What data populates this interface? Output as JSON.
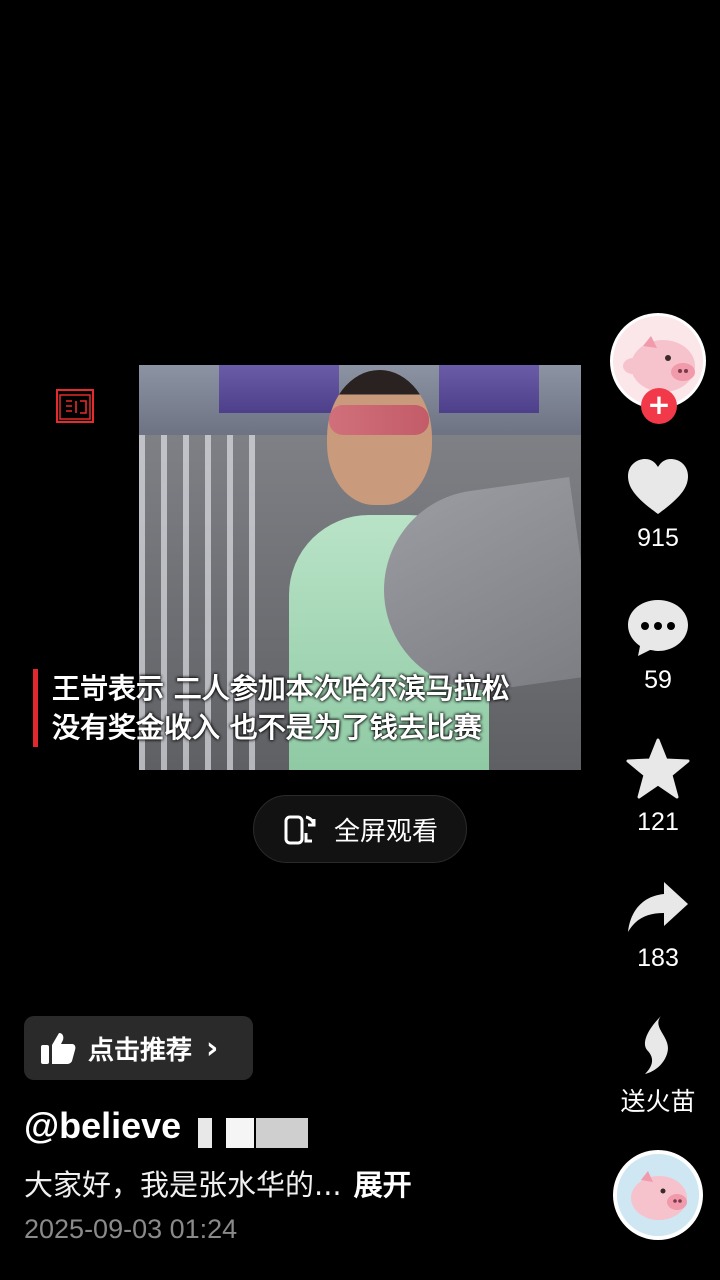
{
  "video": {
    "caption_line1": "王岢表示 二人参加本次哈尔滨马拉松",
    "caption_line2": "没有奖金收入 也不是为了钱去比赛",
    "fullscreen_label": "全屏观看"
  },
  "rail": {
    "like_count": "915",
    "comment_count": "59",
    "favorite_count": "121",
    "share_count": "183",
    "fire_label": "送火苗"
  },
  "post": {
    "recommend_label": "点击推荐",
    "username": "@believe",
    "description": "大家好，我是张水华的...",
    "expand_label": "展开",
    "timestamp": "2025-09-03 01:24"
  },
  "colors": {
    "accent_red": "#e0282e",
    "follow_red": "#f2394a",
    "timestamp_gray": "#8a8a8a"
  }
}
